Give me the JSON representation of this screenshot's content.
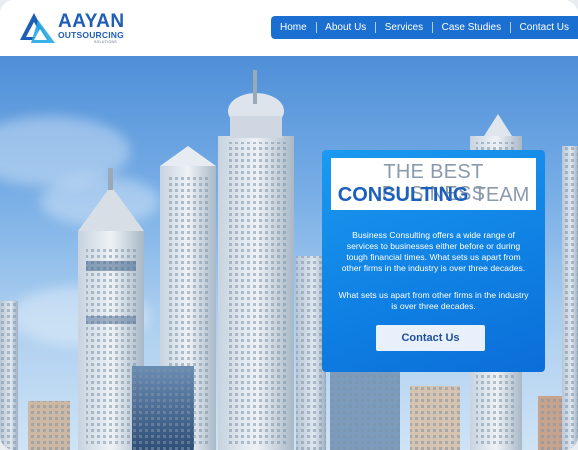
{
  "logo": {
    "brand": "AAYAN",
    "sub": "OUTSOURCING",
    "tiny": "SOLUTIONS"
  },
  "nav": {
    "items": [
      "Home",
      "About Us",
      "Services",
      "Case Studies",
      "Contact Us"
    ]
  },
  "hero": {
    "title_line1": "THE BEST BUSINESS",
    "title_bold": "CONSULTING",
    "title_light": "TEAM",
    "paragraph1": "Business Consulting offers a wide range of services to businesses either before or during tough financial times. What sets us apart from other firms in the industry is over three decades.",
    "paragraph2": "What sets us apart from other firms in the industry is over three decades.",
    "cta_label": "Contact Us"
  },
  "colors": {
    "nav_bg": "#1b6fd0",
    "brand_blue": "#1f5eb5",
    "card_blue": "#0f7fe3"
  }
}
